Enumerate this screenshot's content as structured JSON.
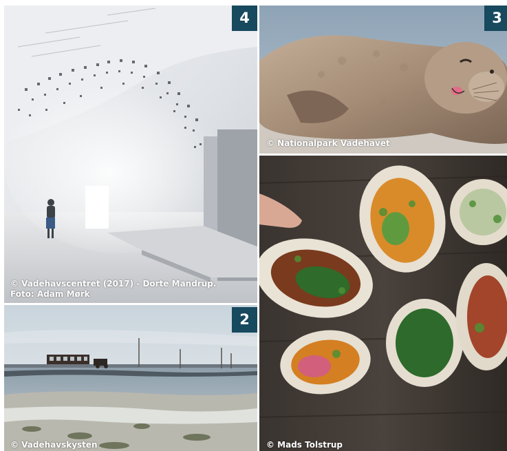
{
  "colors": {
    "badge": "#17495f"
  },
  "tiles": {
    "museum": {
      "badge": "4",
      "credit_line1": "© Vadehavscentret (2017) - Dorte Mandrup.",
      "credit_line2": "Foto: Adam Mørk",
      "subject": "museum-interior-photo"
    },
    "seal": {
      "badge": "3",
      "credit": "© Nationalpark Vadehavet",
      "subject": "seal-photo"
    },
    "mudflat": {
      "badge": "2",
      "credit": "© Vadehavskysten",
      "subject": "mudflat-tractor-photo"
    },
    "oysters": {
      "credit": "© Mads Tolstrup",
      "subject": "oysters-photo"
    }
  }
}
